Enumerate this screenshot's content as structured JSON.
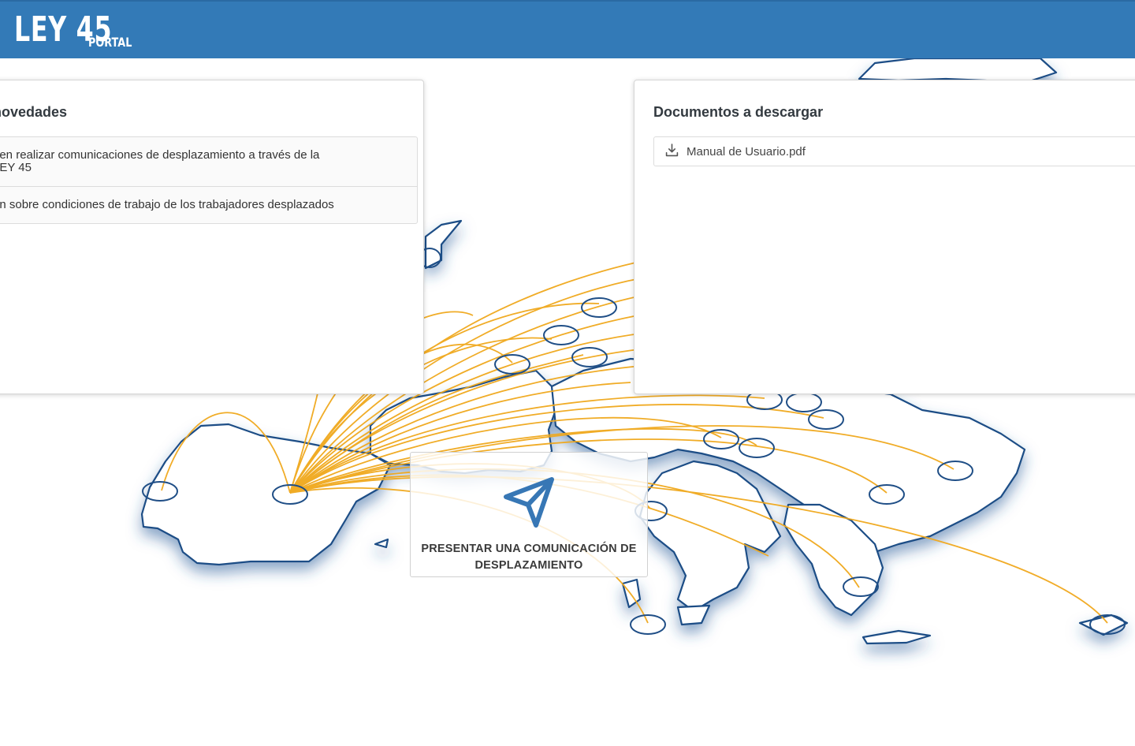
{
  "header": {
    "logo_main": "LEY 45",
    "logo_sub": "PORTAL",
    "background_color": "#337ab7"
  },
  "news_card": {
    "title": "novedades",
    "items": [
      {
        "line1": "den realizar comunicaciones de desplazamiento a través de la",
        "line2": "LEY 45"
      },
      {
        "line1": "ón sobre condiciones de trabajo de los trabajadores desplazados",
        "line2": ""
      }
    ]
  },
  "docs_card": {
    "title": "Documentos a descargar",
    "items": [
      {
        "label": "Manual de Usuario.pdf",
        "icon": "download-icon"
      }
    ]
  },
  "cta": {
    "icon": "paper-plane-icon",
    "label_line1": "PRESENTAR UNA COMUNICACIÓN DE",
    "label_line2": "DESPLAZAMIENTO"
  },
  "map": {
    "line_color": "#f0a81c",
    "border_color": "#1f4e86"
  }
}
